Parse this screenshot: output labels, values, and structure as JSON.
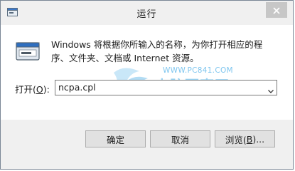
{
  "window": {
    "title": "运行",
    "app_icon": "run-app-icon",
    "close_icon": "close-icon"
  },
  "content": {
    "run_icon": "run-dialog-icon",
    "description": "Windows 将根据你所输入的名称，为你打开相应的程序、文件夹、文档或 Internet 资源。",
    "open_label_prefix": "打开(",
    "open_label_accel": "O",
    "open_label_suffix": "):",
    "open_value": "ncpa.cpl",
    "dropdown_icon": "chevron-down-icon"
  },
  "watermark": {
    "url": "WWW.PC841.COM",
    "name": "电脑百事网"
  },
  "buttons": {
    "ok_label": "确定",
    "cancel_label": "取消",
    "browse_prefix": "浏览(",
    "browse_accel": "B",
    "browse_suffix": ")..."
  },
  "colors": {
    "window_bg": "#f0f0f0",
    "content_bg": "#ffffff",
    "watermark_blue": "#7fc6ef"
  }
}
